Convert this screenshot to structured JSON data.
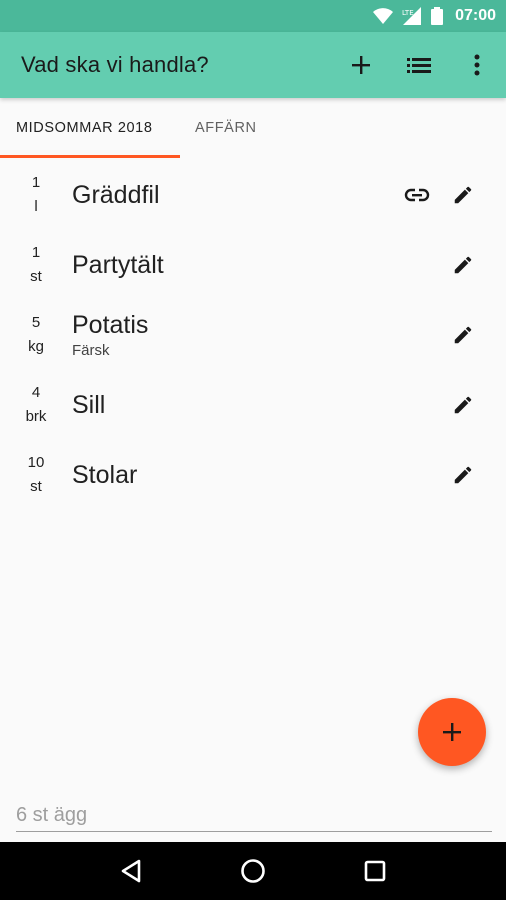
{
  "status": {
    "time": "07:00",
    "network": "LTE"
  },
  "appbar": {
    "title": "Vad ska vi handla?"
  },
  "tabs": [
    {
      "label": "MIDSOMMAR 2018",
      "active": true
    },
    {
      "label": "AFFÄRN",
      "active": false
    }
  ],
  "items": [
    {
      "qty": "1",
      "unit": "l",
      "name": "Gräddfil",
      "note": "",
      "link": true
    },
    {
      "qty": "1",
      "unit": "st",
      "name": "Partytält",
      "note": "",
      "link": false
    },
    {
      "qty": "5",
      "unit": "kg",
      "name": "Potatis",
      "note": "Färsk",
      "link": false
    },
    {
      "qty": "4",
      "unit": "brk",
      "name": "Sill",
      "note": "",
      "link": false
    },
    {
      "qty": "10",
      "unit": "st",
      "name": "Stolar",
      "note": "",
      "link": false
    }
  ],
  "input": {
    "placeholder": "6 st ägg"
  },
  "colors": {
    "accent": "#ff5722",
    "appbar": "#63cdb0",
    "statusbar": "#4bb89a"
  }
}
